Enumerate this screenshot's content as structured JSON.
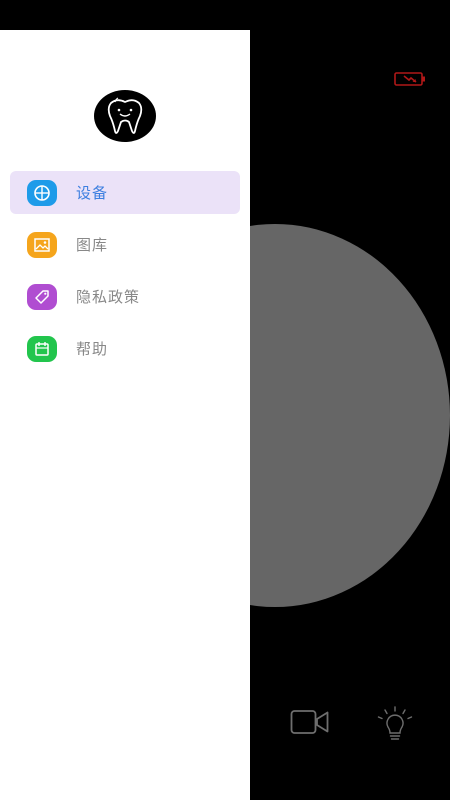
{
  "drawer": {
    "avatar_icon": "tooth-logo-icon",
    "menu": [
      {
        "label": "设备",
        "icon": "grid-globe-icon",
        "color": "#1e9be9",
        "active": true
      },
      {
        "label": "图库",
        "icon": "picture-icon",
        "color": "#f5a51c",
        "active": false
      },
      {
        "label": "隐私政策",
        "icon": "tag-icon",
        "color": "#b04dd1",
        "active": false
      },
      {
        "label": "帮助",
        "icon": "calendar-icon",
        "color": "#22c54d",
        "active": false
      }
    ],
    "active_background": "#ebe2f8",
    "active_text_color": "#3d7fe0",
    "inactive_text_color": "#888888"
  },
  "camera_view": {
    "battery_icon": "battery-low-charging-icon",
    "battery_color": "#b01818",
    "preview_color": "#666666",
    "video_button_icon": "video-camera-icon",
    "light_button_icon": "light-bulb-icon"
  }
}
